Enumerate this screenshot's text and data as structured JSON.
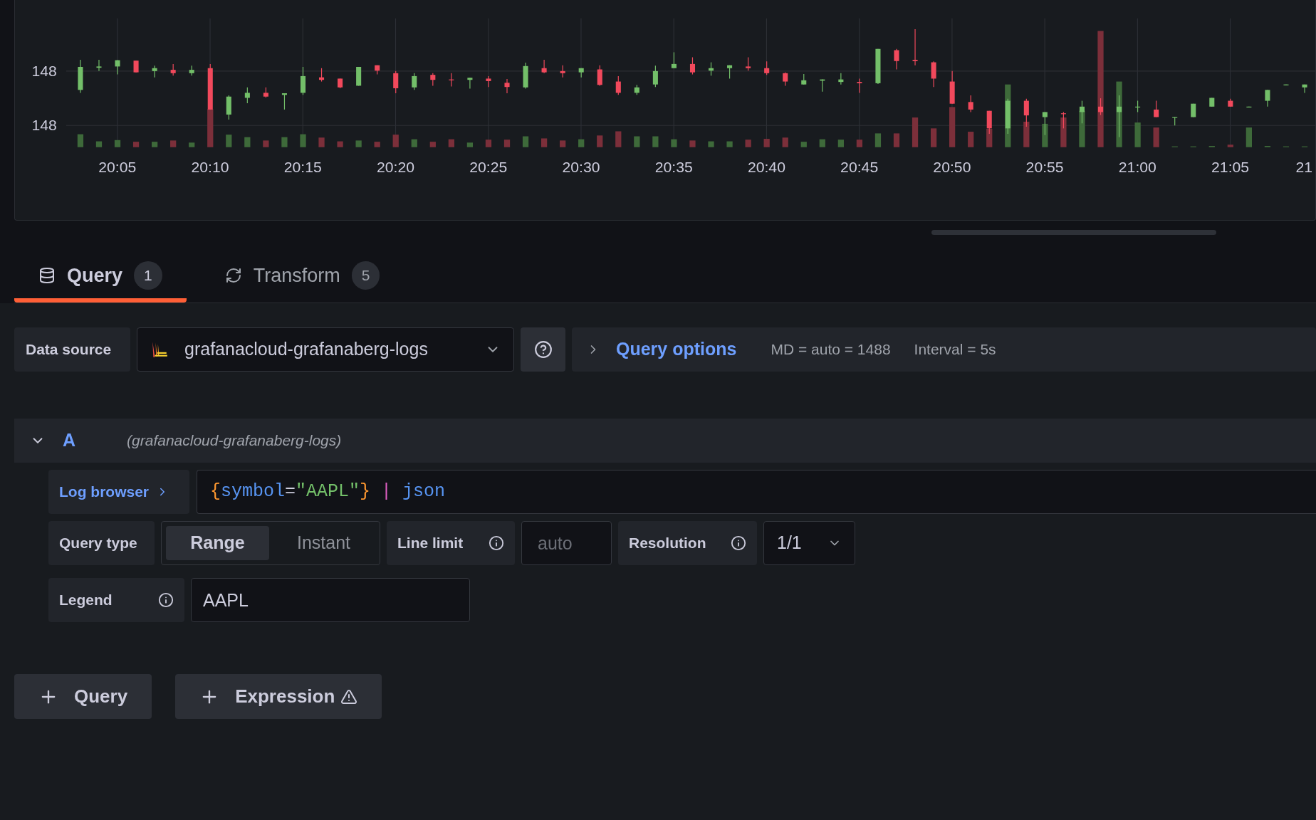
{
  "chart": {
    "y_axis_labels": [
      "148",
      "148"
    ],
    "x_axis_labels": [
      "20:05",
      "20:10",
      "20:15",
      "20:20",
      "20:25",
      "20:30",
      "20:35",
      "20:40",
      "20:45",
      "20:50",
      "20:55",
      "21:00",
      "21:05",
      "21"
    ]
  },
  "tabs": [
    {
      "label": "Query",
      "count": "1",
      "selected": true
    },
    {
      "label": "Transform",
      "count": "5",
      "selected": false
    }
  ],
  "data_source": {
    "label": "Data source",
    "value": "grafanacloud-grafanaberg-logs"
  },
  "query_options": {
    "label": "Query options",
    "expanded": false,
    "max_data_points": "MD = auto = 1488",
    "interval": "Interval = 5s"
  },
  "query": {
    "ref": "A",
    "source": "(grafanacloud-grafanaberg-logs)",
    "expanded": true,
    "log_browser": "Log browser",
    "code": [
      {
        "kind": "brace",
        "text": "{"
      },
      {
        "kind": "label",
        "text": "symbol"
      },
      {
        "kind": "operator",
        "text": "="
      },
      {
        "kind": "string",
        "text": "\"AAPL\""
      },
      {
        "kind": "brace",
        "text": "}"
      },
      {
        "kind": "pipe",
        "text": " | "
      },
      {
        "kind": "function",
        "text": "json"
      }
    ],
    "query_type": {
      "label": "Query type",
      "options": [
        {
          "label": "Range",
          "selected": true
        },
        {
          "label": "Instant",
          "selected": false
        }
      ]
    },
    "line_limit": {
      "label": "Line limit",
      "placeholder": "auto"
    },
    "resolution": {
      "label": "Resolution",
      "value": "1/1"
    },
    "legend": {
      "label": "Legend",
      "value": "AAPL"
    }
  },
  "buttons": [
    {
      "label": "Query",
      "warning": false
    },
    {
      "label": "Expression",
      "warning": true
    }
  ]
}
